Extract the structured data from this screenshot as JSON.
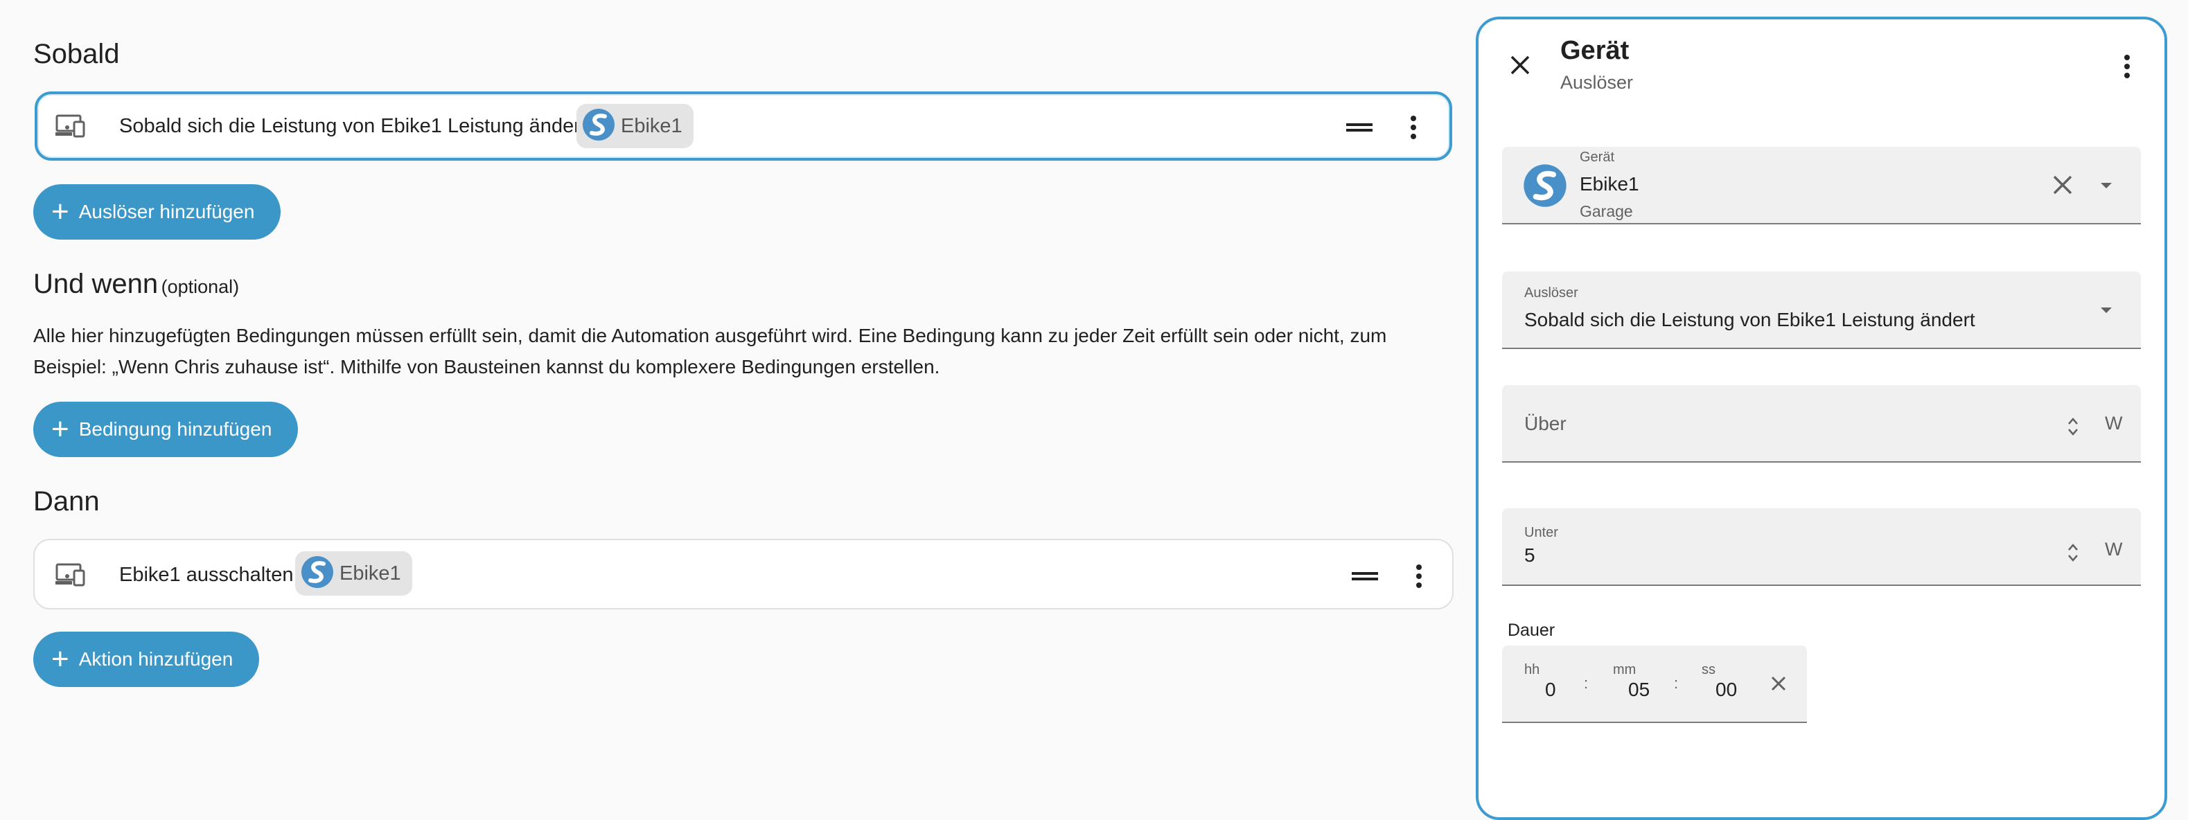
{
  "triggers": {
    "title": "Sobald",
    "items": [
      {
        "icon": "device-icon",
        "text": "Sobald sich die Leistung von Ebike1 Leistung ändert",
        "chip": "Ebike1"
      }
    ],
    "add_label": "Auslöser hinzufügen"
  },
  "conditions": {
    "title": "Und wenn",
    "optional": "(optional)",
    "description_line1": "Alle hier hinzugefügten Bedingungen müssen erfüllt sein, damit die Automation ausgeführt wird. Eine Bedingung kann zu jeder Zeit erfüllt sein oder nicht, zum",
    "description_line2": "Beispiel: „Wenn Chris zuhause ist“. Mithilfe von Bausteinen kannst du komplexere Bedingungen erstellen.",
    "add_label": "Bedingung hinzufügen"
  },
  "actions": {
    "title": "Dann",
    "items": [
      {
        "icon": "device-icon",
        "text": "Ebike1 ausschalten",
        "chip": "Ebike1"
      }
    ],
    "add_label": "Aktion hinzufügen"
  },
  "panel": {
    "title": "Gerät",
    "subtitle": "Auslöser",
    "device_field": {
      "label": "Gerät",
      "value": "Ebike1",
      "area": "Garage"
    },
    "trigger_field": {
      "label": "Auslöser",
      "value": "Sobald sich die Leistung von Ebike1 Leistung ändert"
    },
    "above_field": {
      "placeholder": "Über",
      "unit": "W"
    },
    "below_field": {
      "label": "Unter",
      "value": "5",
      "unit": "W"
    },
    "duration": {
      "label": "Dauer",
      "hh_label": "hh",
      "hh": "0",
      "mm_label": "mm",
      "mm": "05",
      "ss_label": "ss",
      "ss": "00",
      "sep": ":"
    }
  },
  "colors": {
    "accent": "#3c97c9",
    "border_selected": "#3d9bd0",
    "background": "#fafafa"
  }
}
